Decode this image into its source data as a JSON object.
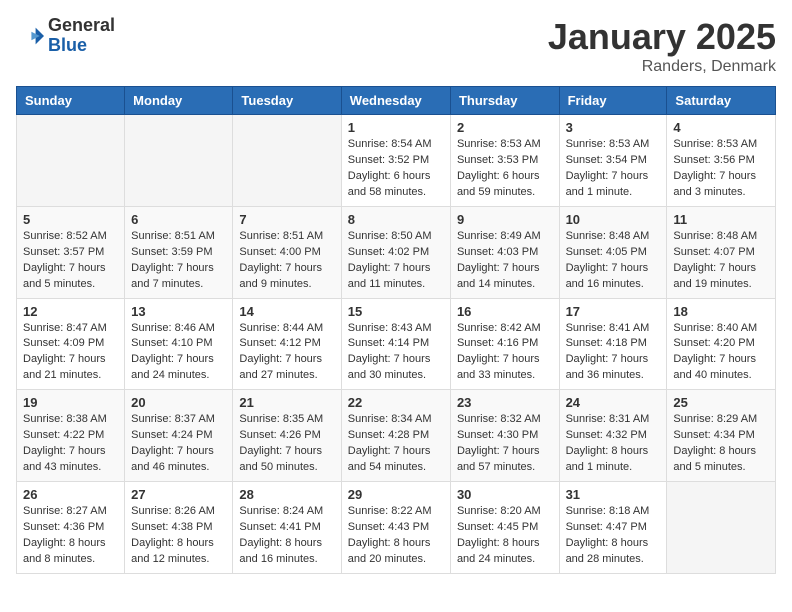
{
  "logo": {
    "general": "General",
    "blue": "Blue"
  },
  "title": "January 2025",
  "location": "Randers, Denmark",
  "weekdays": [
    "Sunday",
    "Monday",
    "Tuesday",
    "Wednesday",
    "Thursday",
    "Friday",
    "Saturday"
  ],
  "weeks": [
    [
      {
        "day": "",
        "info": ""
      },
      {
        "day": "",
        "info": ""
      },
      {
        "day": "",
        "info": ""
      },
      {
        "day": "1",
        "info": "Sunrise: 8:54 AM\nSunset: 3:52 PM\nDaylight: 6 hours\nand 58 minutes."
      },
      {
        "day": "2",
        "info": "Sunrise: 8:53 AM\nSunset: 3:53 PM\nDaylight: 6 hours\nand 59 minutes."
      },
      {
        "day": "3",
        "info": "Sunrise: 8:53 AM\nSunset: 3:54 PM\nDaylight: 7 hours\nand 1 minute."
      },
      {
        "day": "4",
        "info": "Sunrise: 8:53 AM\nSunset: 3:56 PM\nDaylight: 7 hours\nand 3 minutes."
      }
    ],
    [
      {
        "day": "5",
        "info": "Sunrise: 8:52 AM\nSunset: 3:57 PM\nDaylight: 7 hours\nand 5 minutes."
      },
      {
        "day": "6",
        "info": "Sunrise: 8:51 AM\nSunset: 3:59 PM\nDaylight: 7 hours\nand 7 minutes."
      },
      {
        "day": "7",
        "info": "Sunrise: 8:51 AM\nSunset: 4:00 PM\nDaylight: 7 hours\nand 9 minutes."
      },
      {
        "day": "8",
        "info": "Sunrise: 8:50 AM\nSunset: 4:02 PM\nDaylight: 7 hours\nand 11 minutes."
      },
      {
        "day": "9",
        "info": "Sunrise: 8:49 AM\nSunset: 4:03 PM\nDaylight: 7 hours\nand 14 minutes."
      },
      {
        "day": "10",
        "info": "Sunrise: 8:48 AM\nSunset: 4:05 PM\nDaylight: 7 hours\nand 16 minutes."
      },
      {
        "day": "11",
        "info": "Sunrise: 8:48 AM\nSunset: 4:07 PM\nDaylight: 7 hours\nand 19 minutes."
      }
    ],
    [
      {
        "day": "12",
        "info": "Sunrise: 8:47 AM\nSunset: 4:09 PM\nDaylight: 7 hours\nand 21 minutes."
      },
      {
        "day": "13",
        "info": "Sunrise: 8:46 AM\nSunset: 4:10 PM\nDaylight: 7 hours\nand 24 minutes."
      },
      {
        "day": "14",
        "info": "Sunrise: 8:44 AM\nSunset: 4:12 PM\nDaylight: 7 hours\nand 27 minutes."
      },
      {
        "day": "15",
        "info": "Sunrise: 8:43 AM\nSunset: 4:14 PM\nDaylight: 7 hours\nand 30 minutes."
      },
      {
        "day": "16",
        "info": "Sunrise: 8:42 AM\nSunset: 4:16 PM\nDaylight: 7 hours\nand 33 minutes."
      },
      {
        "day": "17",
        "info": "Sunrise: 8:41 AM\nSunset: 4:18 PM\nDaylight: 7 hours\nand 36 minutes."
      },
      {
        "day": "18",
        "info": "Sunrise: 8:40 AM\nSunset: 4:20 PM\nDaylight: 7 hours\nand 40 minutes."
      }
    ],
    [
      {
        "day": "19",
        "info": "Sunrise: 8:38 AM\nSunset: 4:22 PM\nDaylight: 7 hours\nand 43 minutes."
      },
      {
        "day": "20",
        "info": "Sunrise: 8:37 AM\nSunset: 4:24 PM\nDaylight: 7 hours\nand 46 minutes."
      },
      {
        "day": "21",
        "info": "Sunrise: 8:35 AM\nSunset: 4:26 PM\nDaylight: 7 hours\nand 50 minutes."
      },
      {
        "day": "22",
        "info": "Sunrise: 8:34 AM\nSunset: 4:28 PM\nDaylight: 7 hours\nand 54 minutes."
      },
      {
        "day": "23",
        "info": "Sunrise: 8:32 AM\nSunset: 4:30 PM\nDaylight: 7 hours\nand 57 minutes."
      },
      {
        "day": "24",
        "info": "Sunrise: 8:31 AM\nSunset: 4:32 PM\nDaylight: 8 hours\nand 1 minute."
      },
      {
        "day": "25",
        "info": "Sunrise: 8:29 AM\nSunset: 4:34 PM\nDaylight: 8 hours\nand 5 minutes."
      }
    ],
    [
      {
        "day": "26",
        "info": "Sunrise: 8:27 AM\nSunset: 4:36 PM\nDaylight: 8 hours\nand 8 minutes."
      },
      {
        "day": "27",
        "info": "Sunrise: 8:26 AM\nSunset: 4:38 PM\nDaylight: 8 hours\nand 12 minutes."
      },
      {
        "day": "28",
        "info": "Sunrise: 8:24 AM\nSunset: 4:41 PM\nDaylight: 8 hours\nand 16 minutes."
      },
      {
        "day": "29",
        "info": "Sunrise: 8:22 AM\nSunset: 4:43 PM\nDaylight: 8 hours\nand 20 minutes."
      },
      {
        "day": "30",
        "info": "Sunrise: 8:20 AM\nSunset: 4:45 PM\nDaylight: 8 hours\nand 24 minutes."
      },
      {
        "day": "31",
        "info": "Sunrise: 8:18 AM\nSunset: 4:47 PM\nDaylight: 8 hours\nand 28 minutes."
      },
      {
        "day": "",
        "info": ""
      }
    ]
  ]
}
